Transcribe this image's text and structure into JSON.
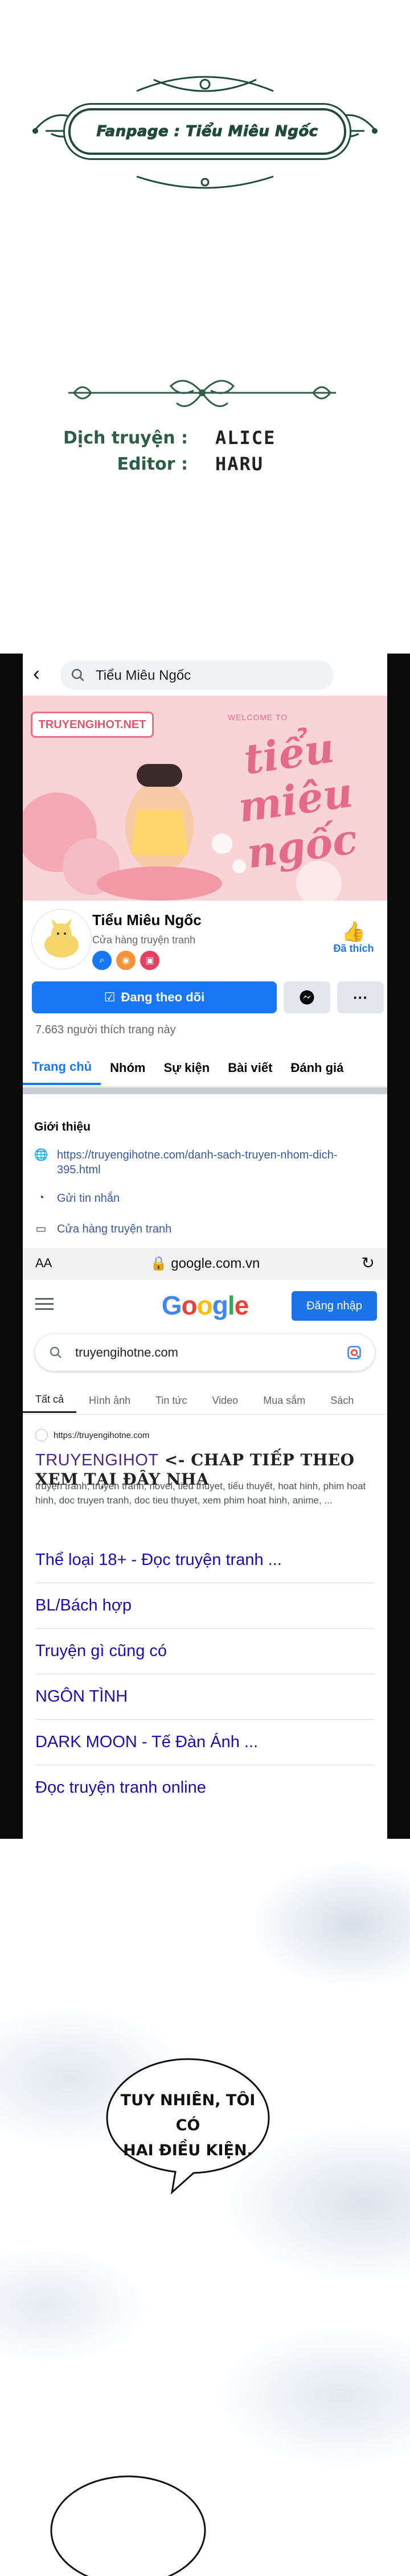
{
  "credits": {
    "fanpage": "Fanpage : Tiểu Miêu Ngốc",
    "translator_label": "Dịch truyện :",
    "translator_name": "ALICE",
    "editor_label": "Editor :",
    "editor_name": "HARU"
  },
  "facebook": {
    "search_text": "Tiểu Miêu Ngốc",
    "cover_logo": "TRUYENGIHOT.NET",
    "cover_welcome": "WELCOME TO",
    "cover_title": "tiểu miêu ngốc",
    "page_name": "Tiểu Miêu Ngốc",
    "page_category": "Cửa hàng truyện tranh",
    "liked_label": "Đã thích",
    "follow_button": "Đang theo dõi",
    "more_button": "···",
    "likes_count": "7.663 người thích trang này",
    "tabs": [
      "Trang chủ",
      "Nhóm",
      "Sự kiện",
      "Bài viết",
      "Đánh giá"
    ],
    "intro_title": "Giới thiệu",
    "intro_link": "https://truyengihotne.com/danh-sach-truyen-nhom-dich-395.html",
    "send_message": "Gửi tin nhắn",
    "shop_link": "Cửa hàng truyện tranh"
  },
  "browser": {
    "aa": "AA",
    "url": "google.com.vn"
  },
  "google": {
    "login_button": "Đăng nhập",
    "query": "truyengihotne.com",
    "tabs": [
      "Tất cả",
      "Hình ảnh",
      "Tin tức",
      "Video",
      "Mua sắm",
      "Sách"
    ],
    "result_url": "https://truyengihotne.com",
    "result_title_site": "TRUYENGIHOT",
    "result_title_rest": " <- CHAP TIẾP THEO XEM TẠI ĐÂY NHA",
    "result_snippet": "truyện tranh, truyen tranh, novel, tieu thuyet, tiểu thuyết, hoat hinh, phim hoat hinh, doc truyen tranh, doc tieu thuyet, xem phim hoat hinh, anime, ...",
    "sitelinks": [
      "Thể loại 18+ - Đọc truyện tranh ...",
      "BL/Bách hợp",
      "Truyện gì cũng có",
      "NGÔN TÌNH",
      "DARK MOON - Tế Đàn Ánh ...",
      "Đọc truyện tranh online"
    ]
  },
  "comic": {
    "speech_line1": "TUY NHIÊN, TÔI CÓ",
    "speech_line2": "HAI ĐIỀU KIỆN."
  },
  "colors": {
    "fb_blue": "#1877f2",
    "banner_green": "#1f4a3c",
    "google_link": "#1a0dab"
  }
}
